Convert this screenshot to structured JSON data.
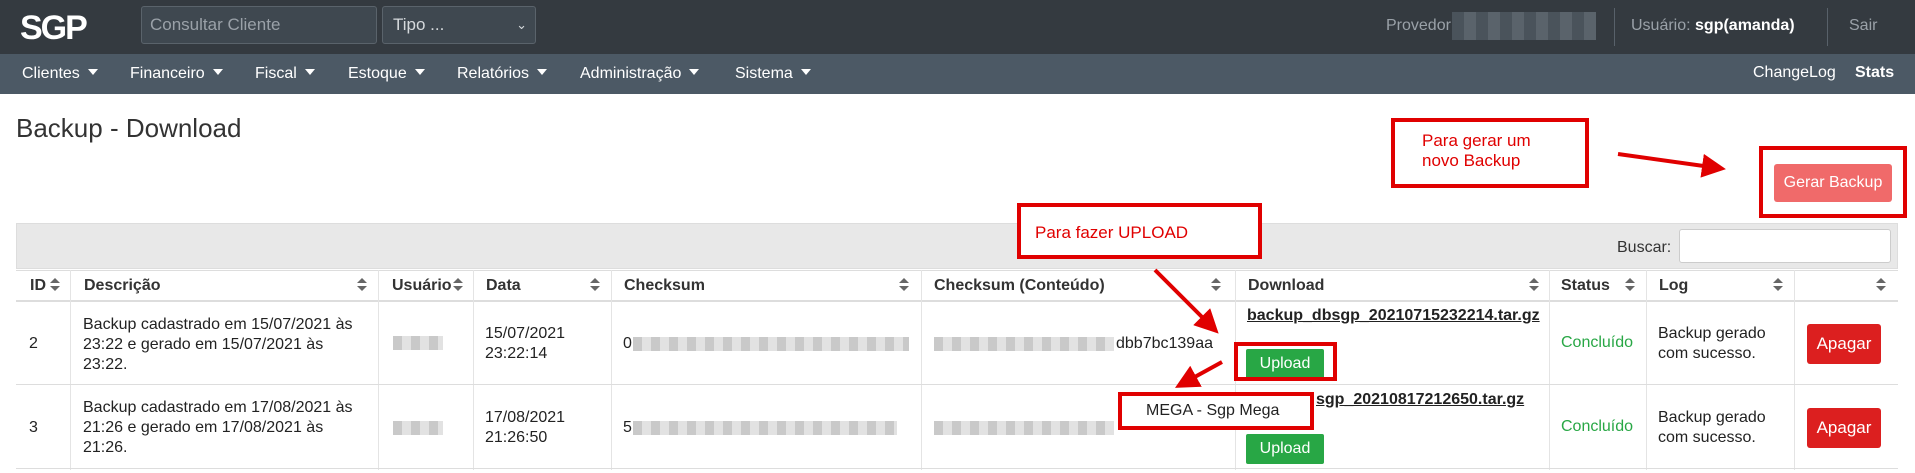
{
  "header": {
    "logo_text": "SGP",
    "search_placeholder": "Consultar Cliente",
    "tipo_select": "Tipo ...",
    "provedor_label": "Provedor:",
    "usuario_label": "Usuário:",
    "usuario_name": "sgp(amanda)",
    "logout": "Sair"
  },
  "menu": {
    "items": [
      "Clientes",
      "Financeiro",
      "Fiscal",
      "Estoque",
      "Relatórios",
      "Administração",
      "Sistema"
    ],
    "changelog": "ChangeLog",
    "stats": "Stats"
  },
  "page": {
    "title": "Backup - Download",
    "gerar_backup": "Gerar Backup"
  },
  "annotations": {
    "gerar_line1": "Para gerar um",
    "gerar_line2": "novo Backup",
    "upload": "Para fazer UPLOAD",
    "colors": {
      "box": "#e00000"
    }
  },
  "table": {
    "search_label": "Buscar:",
    "columns": [
      "ID",
      "Descrição",
      "Usuário",
      "Data",
      "Checksum",
      "Checksum (Conteúdo)",
      "Download",
      "Status",
      "Log",
      ""
    ],
    "rows": [
      {
        "id": "2",
        "descricao": [
          "Backup cadastrado em 15/07/2021 às",
          "23:22 e gerado em 15/07/2021 às",
          "23:22."
        ],
        "data": [
          "15/07/2021",
          "23:22:14"
        ],
        "checksum_prefix": "0",
        "checksum_conteudo_suffix": "dbb7bc139aa",
        "download": "backup_dbsgp_20210715232214.tar.gz",
        "upload": "Upload",
        "status": "Concluído",
        "log": [
          "Backup gerado",
          "com sucesso."
        ],
        "action": "Apagar"
      },
      {
        "id": "3",
        "descricao": [
          "Backup cadastrado em 17/08/2021 às",
          "21:26 e gerado em 17/08/2021 às",
          "21:26."
        ],
        "data": [
          "17/08/2021",
          "21:26:50"
        ],
        "checksum_prefix": "5",
        "checksum_conteudo_suffix": "",
        "download": "sgp_20210817212650.tar.gz",
        "upload": "Upload",
        "status": "Concluído",
        "log": [
          "Backup gerado",
          "com sucesso."
        ],
        "action": "Apagar"
      }
    ],
    "upload_menu_option": "MEGA - Sgp Mega"
  }
}
